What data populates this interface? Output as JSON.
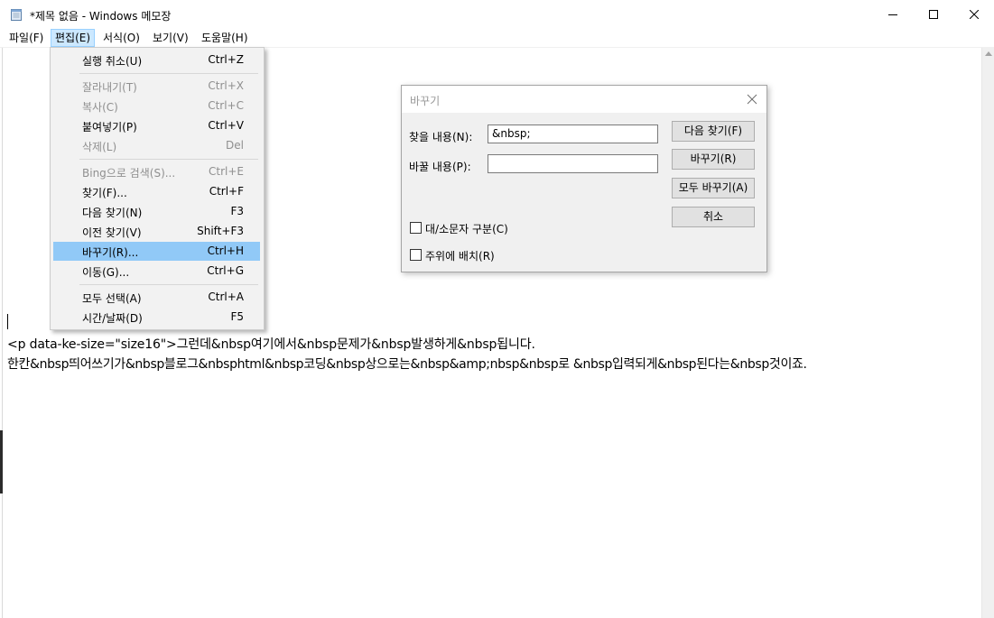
{
  "window": {
    "title": "*제목 없음 - Windows 메모장",
    "icon": "notepad-icon"
  },
  "menubar": {
    "file": "파일(F)",
    "edit": "편집(E)",
    "format": "서식(O)",
    "view": "보기(V)",
    "help": "도움말(H)"
  },
  "edit_menu": {
    "items": [
      {
        "label": "실행 취소(U)",
        "shortcut": "Ctrl+Z",
        "enabled": true
      },
      {
        "label": "잘라내기(T)",
        "shortcut": "Ctrl+X",
        "enabled": false
      },
      {
        "label": "복사(C)",
        "shortcut": "Ctrl+C",
        "enabled": false
      },
      {
        "label": "붙여넣기(P)",
        "shortcut": "Ctrl+V",
        "enabled": true
      },
      {
        "label": "삭제(L)",
        "shortcut": "Del",
        "enabled": false
      },
      {
        "label": "Bing으로 검색(S)...",
        "shortcut": "Ctrl+E",
        "enabled": false
      },
      {
        "label": "찾기(F)...",
        "shortcut": "Ctrl+F",
        "enabled": true
      },
      {
        "label": "다음 찾기(N)",
        "shortcut": "F3",
        "enabled": true
      },
      {
        "label": "이전 찾기(V)",
        "shortcut": "Shift+F3",
        "enabled": true
      },
      {
        "label": "바꾸기(R)...",
        "shortcut": "Ctrl+H",
        "enabled": true,
        "highlighted": true
      },
      {
        "label": "이동(G)...",
        "shortcut": "Ctrl+G",
        "enabled": true
      },
      {
        "label": "모두 선택(A)",
        "shortcut": "Ctrl+A",
        "enabled": true
      },
      {
        "label": "시간/날짜(D)",
        "shortcut": "F5",
        "enabled": true
      }
    ]
  },
  "replace_dialog": {
    "title": "바꾸기",
    "find_label": "찾을 내용(N):",
    "find_value": "&nbsp;",
    "replace_label": "바꿀 내용(P):",
    "replace_value": "",
    "find_next_button": "다음 찾기(F)",
    "replace_button": "바꾸기(R)",
    "replace_all_button": "모두 바꾸기(A)",
    "cancel_button": "취소",
    "match_case_label": "대/소문자 구분(C)",
    "match_case_checked": false,
    "wrap_around_label": "주위에 배치(R)",
    "wrap_around_checked": false
  },
  "editor": {
    "line1": "<p data-ke-size=\"size16\">그런데&nbsp여기에서&nbsp문제가&nbsp발생하게&nbsp됩니다.",
    "line2": " 한칸&nbsp띄어쓰기가&nbsp블로그&nbsphtml&nbsp코딩&nbsp상으로는&nbsp&amp;nbsp&nbsp로  &nbsp입력되게&nbsp된다는&nbsp것이죠."
  },
  "colors": {
    "menu_highlight": "#91c9f7",
    "menubar_active": "#cce8ff",
    "dialog_bg": "#f0f0f0",
    "disabled_text": "#8f8f8f"
  }
}
